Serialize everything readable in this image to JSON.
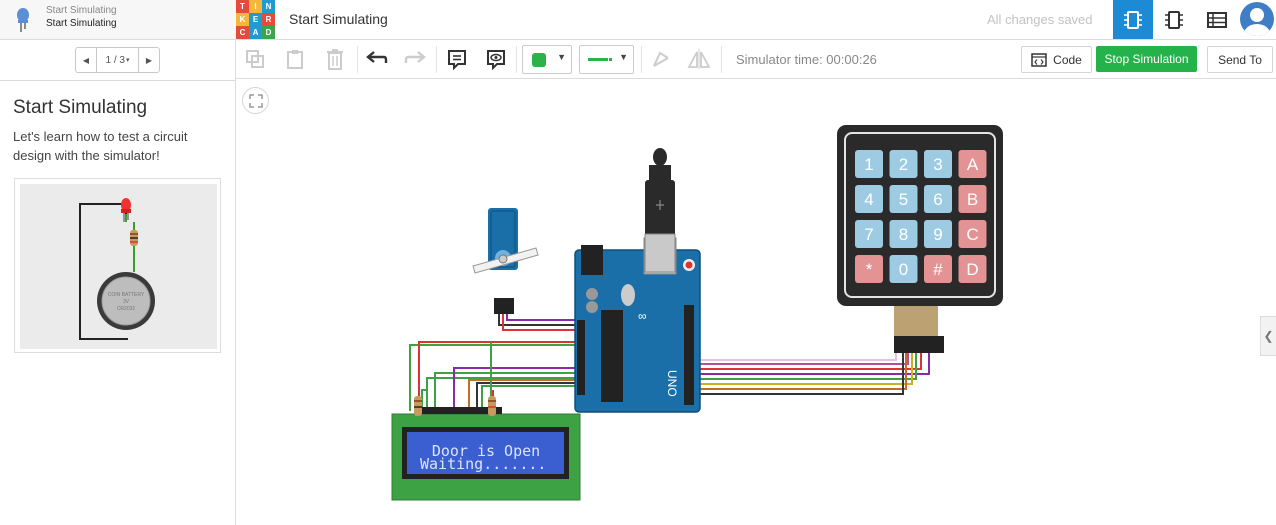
{
  "lesson_header": {
    "course_title": "Start Simulating",
    "lesson_title": "Start Simulating"
  },
  "pager": {
    "prev_icon": "chevron-left-icon",
    "label": "1 / 3",
    "next_icon": "chevron-right-icon"
  },
  "lesson": {
    "title": "Start Simulating",
    "description": "Let's learn how to test a circuit design with the simulator!",
    "battery_lines": [
      "COIN BATTERY",
      "3V",
      "CR2032"
    ]
  },
  "header": {
    "logo_letters": [
      "T",
      "I",
      "N",
      "K",
      "E",
      "R",
      "C",
      "A",
      "D"
    ],
    "doc_title": "Start Simulating",
    "save_status": "All changes saved"
  },
  "toolbar": {
    "sim_time": "Simulator time: 00:00:26",
    "code_label": "Code",
    "stop_label": "Stop Simulation",
    "send_label": "Send To"
  },
  "colors": {
    "accent_blue": "#1d8ad6",
    "stop_green": "#24b24a",
    "arduino_blue": "#1b6fa8",
    "lcd_green": "#3ca243",
    "lcd_screen": "#3b5fd0",
    "keypad_blue": "#9ccbe3",
    "keypad_red": "#e39393"
  },
  "circuit": {
    "lcd_lines": [
      "Door is Open",
      "Waiting......."
    ],
    "arduino_model": "UNO",
    "keypad_keys": [
      "1",
      "2",
      "3",
      "A",
      "4",
      "5",
      "6",
      "B",
      "7",
      "8",
      "9",
      "C",
      "*",
      "0",
      "#",
      "D"
    ]
  }
}
